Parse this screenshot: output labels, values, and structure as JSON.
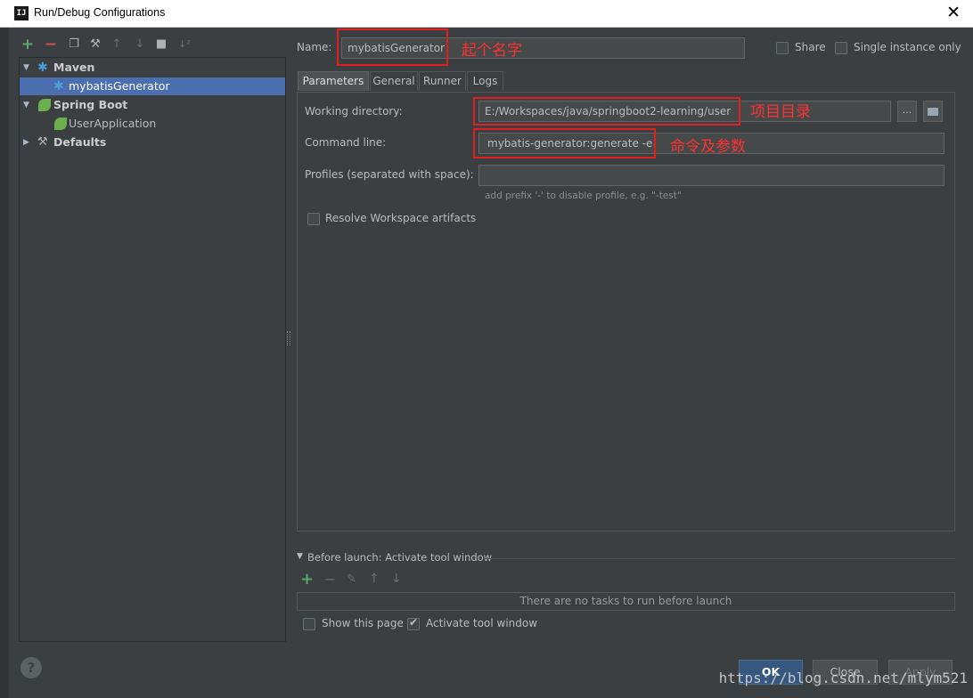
{
  "window": {
    "title": "Run/Debug Configurations",
    "app_icon": "IJ"
  },
  "toolbar": {
    "add": "+",
    "remove": "−",
    "copy": "❐",
    "wrench": "⚒",
    "up": "↑",
    "down": "↓",
    "folder": "■",
    "sort": "↓²"
  },
  "tree": {
    "maven": "Maven",
    "maven_child": "mybatisGenerator",
    "spring": "Spring Boot",
    "spring_child": "UserApplication",
    "defaults": "Defaults"
  },
  "name_field": {
    "label": "Name:",
    "value": "mybatisGenerator",
    "note": "起个名字"
  },
  "share": {
    "label": "Share",
    "checked": false
  },
  "single_instance": {
    "label": "Single instance only",
    "checked": false
  },
  "tabs": [
    "Parameters",
    "General",
    "Runner",
    "Logs"
  ],
  "params": {
    "working_dir_label": "Working directory:",
    "working_dir_value": "E:/Workspaces/java/springboot2-learning/user",
    "working_dir_note": "项目目录",
    "browse_label": "...",
    "command_label": "Command line:",
    "command_value": "mybatis-generator:generate -e",
    "command_note": "命令及参数",
    "profiles_label": "Profiles (separated with space):",
    "profiles_value": "",
    "profiles_hint": "add prefix '-' to disable profile, e.g. \"-test\"",
    "resolve_label": "Resolve Workspace artifacts"
  },
  "before_launch": {
    "header": "Before launch: Activate tool window",
    "empty_text": "There are no tasks to run before launch",
    "show_page": "Show this page",
    "activate_tool": "Activate tool window"
  },
  "buttons": {
    "ok": "OK",
    "close": "Close",
    "apply": "Apply",
    "help": "?"
  },
  "watermark": "https://blog.csdn.net/mlym521",
  "colors": {
    "background": "#3c3f41",
    "selection": "#4b6eaf",
    "annotation": "#e02020",
    "ok_button": "#365880"
  }
}
